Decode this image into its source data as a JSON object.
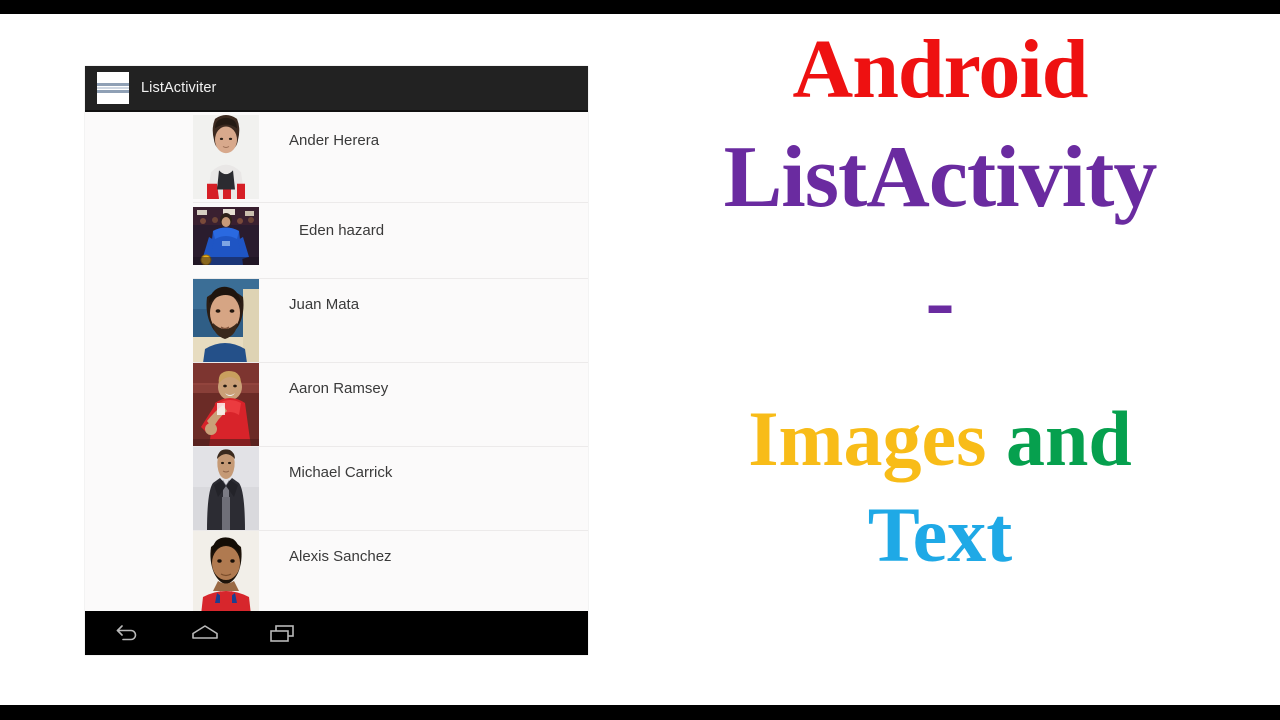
{
  "phone": {
    "action_bar": {
      "app_icon": "list-lines-icon",
      "title": "ListActiviter"
    },
    "list_items": [
      {
        "name": "Ander Herera",
        "image": "player-portrait-ander-herera"
      },
      {
        "name": "Eden hazard",
        "image": "player-photo-eden-hazard"
      },
      {
        "name": "Juan Mata",
        "image": "player-photo-juan-mata"
      },
      {
        "name": "Aaron Ramsey",
        "image": "player-photo-aaron-ramsey"
      },
      {
        "name": "Michael Carrick",
        "image": "player-photo-michael-carrick"
      },
      {
        "name": "Alexis Sanchez",
        "image": "player-portrait-alexis-sanchez"
      }
    ],
    "nav_bar": {
      "back": "back-icon",
      "home": "home-icon",
      "recents": "recent-apps-icon"
    }
  },
  "titles": {
    "line1": "Android",
    "line2": "ListActivity",
    "line3": "-",
    "line4_a": "Images",
    "line4_b": "and",
    "line5": "Text"
  },
  "colors": {
    "red": "#ee1111",
    "purple": "#6a2ba0",
    "gold": "#f8bc18",
    "green": "#06a04e",
    "cyan": "#1fa9e6",
    "action_bar": "#222222",
    "list_bg": "#fbfafa",
    "text": "#3a3a3a",
    "letterbox": "#000000"
  }
}
